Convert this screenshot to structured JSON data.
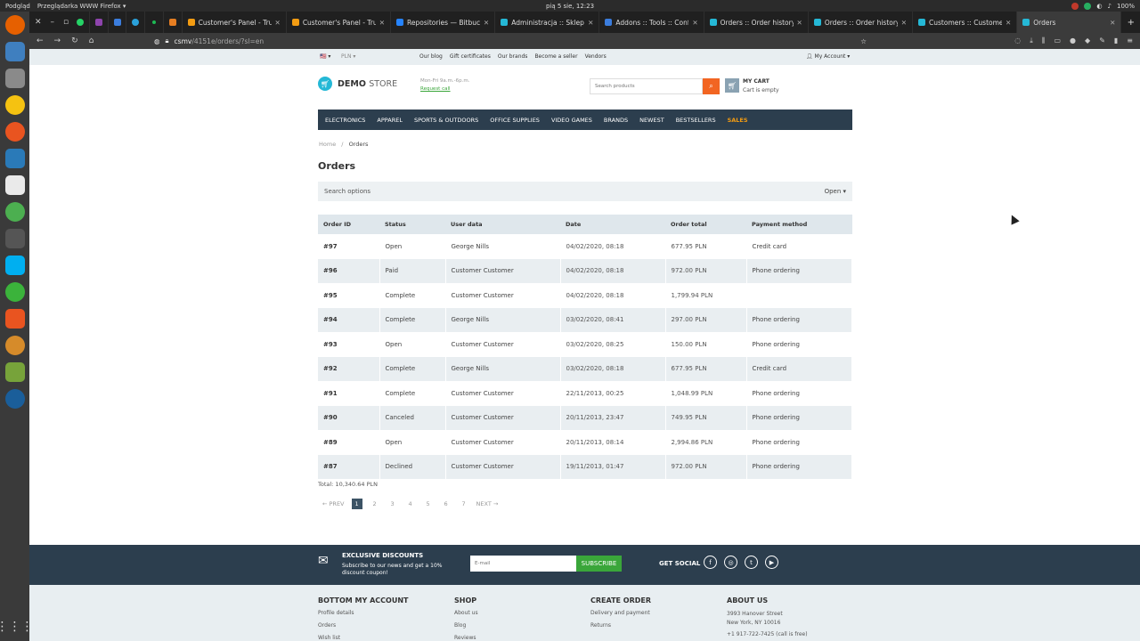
{
  "os": {
    "preview_label": "Podgląd",
    "app_label": "Przeglądarka WWW Firefox ▾",
    "clock": "pią 5 sie, 12:23",
    "battery": "100%"
  },
  "browser": {
    "tabs": [
      {
        "title": "Customer's Panel - Trust",
        "color": "#f39c12"
      },
      {
        "title": "Customer's Panel - Trust",
        "color": "#f39c12"
      },
      {
        "title": "Repositories — Bitbucket",
        "color": "#2684ff"
      },
      {
        "title": "Administracja :: Sklepy &",
        "color": "#25b8d6"
      },
      {
        "title": "Addons :: Tools :: Configu",
        "color": "#3b7ddd"
      },
      {
        "title": "Orders :: Order history -",
        "color": "#25b8d6"
      },
      {
        "title": "Orders :: Order history -",
        "color": "#25b8d6"
      },
      {
        "title": "Customers :: Customers",
        "color": "#25b8d6"
      },
      {
        "title": "Orders",
        "color": "#25b8d6"
      }
    ],
    "url_host": "csmv",
    "url_path": "/4151e/orders/?sl=en"
  },
  "store": {
    "top_links": [
      "Our blog",
      "Gift certificates",
      "Our brands",
      "Become a seller",
      "Vendors"
    ],
    "currency": "PLN ▾",
    "account": "My Account ▾",
    "logo_bold": "DEMO",
    "logo_light": "STORE",
    "hours": "Mon-Fri 9a.m.-6p.m.",
    "request_call": "Request call",
    "search_placeholder": "Search products",
    "cart_title": "MY CART",
    "cart_status": "Cart is empty",
    "menu": [
      "ELECTRONICS",
      "APPAREL",
      "SPORTS & OUTDOORS",
      "OFFICE SUPPLIES",
      "VIDEO GAMES",
      "BRANDS",
      "NEWEST",
      "BESTSELLERS"
    ],
    "menu_sales": "SALES"
  },
  "breadcrumb": {
    "home": "Home",
    "sep": "/",
    "current": "Orders"
  },
  "page_title": "Orders",
  "search_options": {
    "label": "Search options",
    "toggle": "Open ▾"
  },
  "orders_table": {
    "headers": [
      "Order ID",
      "Status",
      "User data",
      "Date",
      "Order total",
      "Payment method"
    ],
    "rows": [
      [
        "#97",
        "Open",
        "George Nills",
        "04/02/2020, 08:18",
        "677.95 PLN",
        "Credit card"
      ],
      [
        "#96",
        "Paid",
        "Customer Customer",
        "04/02/2020, 08:18",
        "972.00 PLN",
        "Phone ordering"
      ],
      [
        "#95",
        "Complete",
        "Customer Customer",
        "04/02/2020, 08:18",
        "1,799.94 PLN",
        ""
      ],
      [
        "#94",
        "Complete",
        "George Nills",
        "03/02/2020, 08:41",
        "297.00 PLN",
        "Phone ordering"
      ],
      [
        "#93",
        "Open",
        "Customer Customer",
        "03/02/2020, 08:25",
        "150.00 PLN",
        "Phone ordering"
      ],
      [
        "#92",
        "Complete",
        "George Nills",
        "03/02/2020, 08:18",
        "677.95 PLN",
        "Credit card"
      ],
      [
        "#91",
        "Complete",
        "Customer Customer",
        "22/11/2013, 00:25",
        "1,048.99 PLN",
        "Phone ordering"
      ],
      [
        "#90",
        "Canceled",
        "Customer Customer",
        "20/11/2013, 23:47",
        "749.95 PLN",
        "Phone ordering"
      ],
      [
        "#89",
        "Open",
        "Customer Customer",
        "20/11/2013, 08:14",
        "2,994.86 PLN",
        "Phone ordering"
      ],
      [
        "#87",
        "Declined",
        "Customer Customer",
        "19/11/2013, 01:47",
        "972.00 PLN",
        "Phone ordering"
      ]
    ]
  },
  "total": "Total: 10,340.64 PLN",
  "pagination": {
    "prev": "← PREV",
    "pages": [
      "1",
      "2",
      "3",
      "4",
      "5",
      "6",
      "7"
    ],
    "current": "1",
    "next": "NEXT →"
  },
  "newsletter": {
    "title": "EXCLUSIVE DISCOUNTS",
    "text": "Subscribe to our news and get a 10% discount coupon!",
    "email_placeholder": "E-mail",
    "button": "SUBSCRIBE",
    "social_label": "GET SOCIAL"
  },
  "footer": {
    "col1": {
      "title": "BOTTOM MY ACCOUNT",
      "links": [
        "Profile details",
        "Orders",
        "Wish list"
      ]
    },
    "col2": {
      "title": "SHOP",
      "links": [
        "About us",
        "Blog",
        "Reviews"
      ]
    },
    "col3": {
      "title": "CREATE ORDER",
      "links": [
        "Delivery and payment",
        "Returns"
      ]
    },
    "col4": {
      "title": "ABOUT US",
      "address": [
        "3993 Hanover Street",
        "New York, NY 10016",
        "+1 917-722-7425 (call is free)"
      ]
    }
  }
}
